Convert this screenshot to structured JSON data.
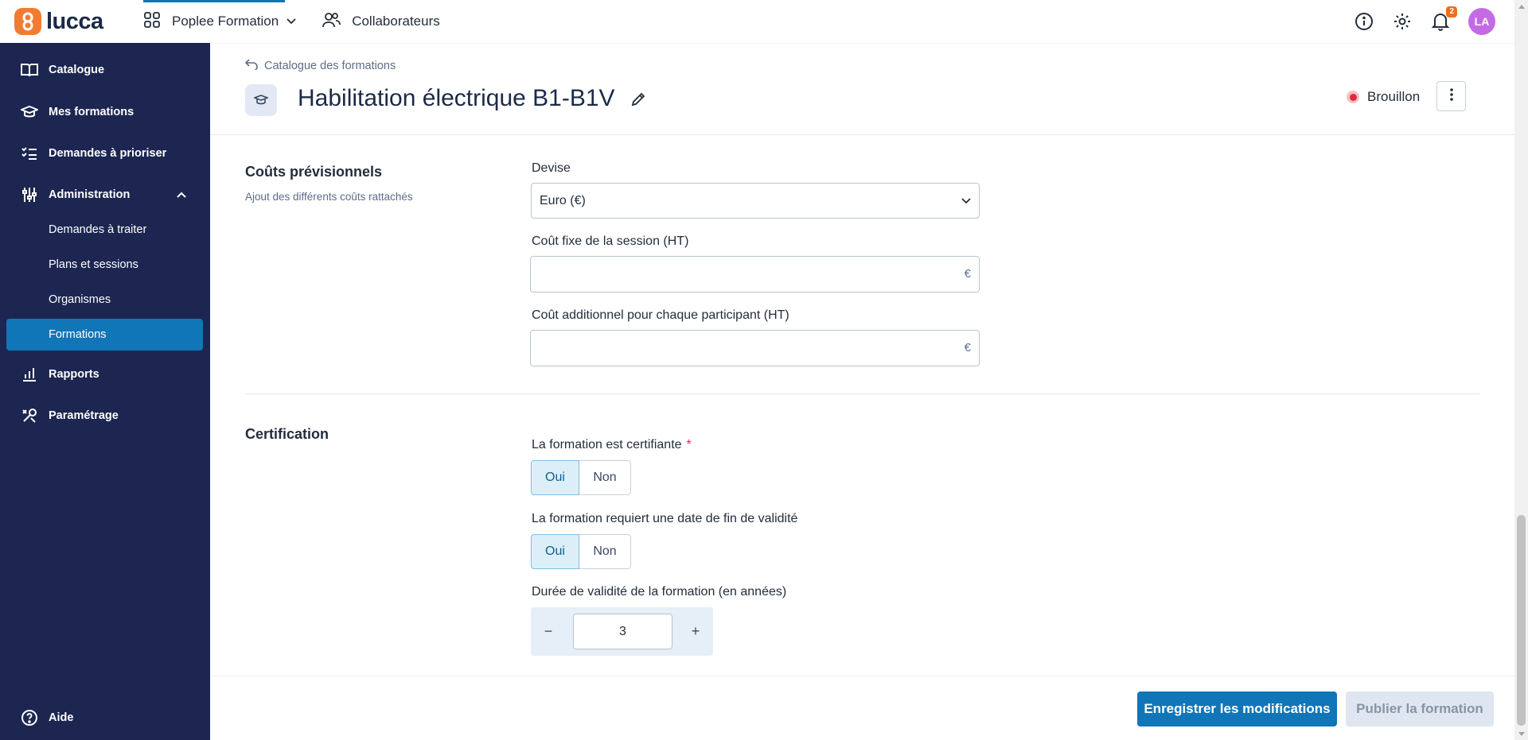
{
  "topbar": {
    "logo_text": "lucca",
    "app_switcher_label": "Poplee Formation",
    "collaborators_label": "Collaborateurs",
    "notification_count": "2",
    "avatar_initials": "LA",
    "icons": [
      "apps-grid-icon",
      "chevron-down-icon",
      "users-icon",
      "info-icon",
      "gear-icon",
      "bell-icon"
    ]
  },
  "sidebar": {
    "items": [
      {
        "label": "Catalogue",
        "icon": "book-icon"
      },
      {
        "label": "Mes formations",
        "icon": "graduation-cap-icon"
      },
      {
        "label": "Demandes à prioriser",
        "icon": "checklist-icon"
      },
      {
        "label": "Administration",
        "icon": "sliders-icon",
        "expanded": true
      }
    ],
    "subitems": [
      {
        "label": "Demandes à traiter"
      },
      {
        "label": "Plans et sessions"
      },
      {
        "label": "Organismes"
      },
      {
        "label": "Formations",
        "active": true
      }
    ],
    "bottom_items": [
      {
        "label": "Rapports",
        "icon": "bar-chart-icon"
      },
      {
        "label": "Paramétrage",
        "icon": "tools-icon"
      }
    ],
    "help_label": "Aide"
  },
  "header": {
    "breadcrumb": "Catalogue des formations",
    "title": "Habilitation électrique B1-B1V",
    "status": "Brouillon"
  },
  "costs": {
    "title": "Coûts prévisionnels",
    "subtitle": "Ajout des différents coûts rattachés",
    "currency_label": "Devise",
    "currency_value": "Euro (€)",
    "fixed_cost_label": "Coût fixe de la session (HT)",
    "fixed_cost_value": "",
    "additional_cost_label": "Coût additionnel pour chaque participant (HT)",
    "additional_cost_value": "",
    "currency_suffix": "€"
  },
  "certification": {
    "title": "Certification",
    "certifying_label": "La formation est certifiante",
    "required_mark": "*",
    "certifying_options": [
      "Oui",
      "Non"
    ],
    "certifying_selected": "Oui",
    "end_date_label": "La formation requiert une date de fin de validité",
    "end_date_options": [
      "Oui",
      "Non"
    ],
    "end_date_selected": "Oui",
    "duration_label": "Durée de validité de la formation (en années)",
    "duration_value": "3",
    "decrement": "−",
    "increment": "+"
  },
  "footer": {
    "save_label": "Enregistrer les modifications",
    "publish_label": "Publier la formation"
  },
  "colors": {
    "sidebar_bg": "#1c2651",
    "primary": "#1176b8",
    "brand_orange": "#f27b32",
    "status_red": "#e12b3c",
    "avatar": "#c46ae5"
  }
}
